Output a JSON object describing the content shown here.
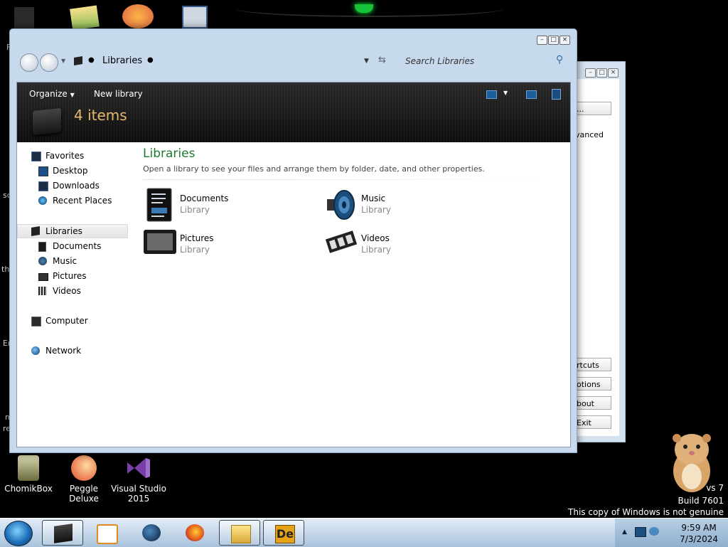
{
  "desktop": {
    "icons": [
      {
        "label": "ChomikBox"
      },
      {
        "label": "Peggle Deluxe"
      },
      {
        "label": "Visual Studio 2015"
      }
    ],
    "left_fragments": [
      "F",
      "sc",
      "th",
      "Er",
      "m",
      "re"
    ],
    "watermark": {
      "line1": "vs 7",
      "line2": "Build 7601",
      "line3": "This copy of Windows is not genuine"
    }
  },
  "background_window": {
    "button_top": "...",
    "text_fragment": "vanced",
    "buttons": [
      "rtcuts",
      "otions",
      "bout",
      "Exit"
    ]
  },
  "explorer": {
    "breadcrumb": "Libraries",
    "search_placeholder": "Search Libraries",
    "toolbar": {
      "organize": "Organize",
      "new_library": "New library"
    },
    "item_count": "4 items",
    "nav": {
      "favorites": "Favorites",
      "favorites_items": [
        "Desktop",
        "Downloads",
        "Recent Places"
      ],
      "libraries": "Libraries",
      "libraries_items": [
        "Documents",
        "Music",
        "Pictures",
        "Videos"
      ],
      "computer": "Computer",
      "network": "Network"
    },
    "main": {
      "title": "Libraries",
      "subtitle": "Open a library to see your files and arrange them by folder, date, and other properties.",
      "libraries": [
        {
          "name": "Documents",
          "type": "Library"
        },
        {
          "name": "Music",
          "type": "Library"
        },
        {
          "name": "Pictures",
          "type": "Library"
        },
        {
          "name": "Videos",
          "type": "Library"
        }
      ]
    }
  },
  "taskbar": {
    "time": "9:59 AM",
    "date": "7/3/2024"
  },
  "colors": {
    "title_green": "#1e7a2e",
    "count_orange": "#e8b86d",
    "window_frame": "#c7d9ec"
  }
}
